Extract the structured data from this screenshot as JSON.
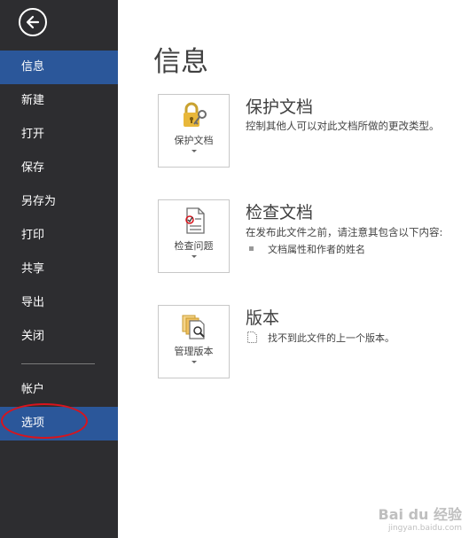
{
  "sidebar": {
    "items": [
      {
        "label": "信息"
      },
      {
        "label": "新建"
      },
      {
        "label": "打开"
      },
      {
        "label": "保存"
      },
      {
        "label": "另存为"
      },
      {
        "label": "打印"
      },
      {
        "label": "共享"
      },
      {
        "label": "导出"
      },
      {
        "label": "关闭"
      },
      {
        "label": "帐户"
      },
      {
        "label": "选项"
      }
    ],
    "active_item": "信息",
    "highlighted_item": "选项"
  },
  "main": {
    "title": "信息",
    "sections": [
      {
        "button_label": "保护文档",
        "heading": "保护文档",
        "description": "控制其他人可以对此文档所做的更改类型。",
        "icon": "lock-key-icon"
      },
      {
        "button_label": "检查问题",
        "heading": "检查文档",
        "description": "在发布此文件之前，请注意其包含以下内容:",
        "bullet": "文档属性和作者的姓名",
        "icon": "checklist-icon"
      },
      {
        "button_label": "管理版本",
        "heading": "版本",
        "description": "找不到此文件的上一个版本。",
        "icon": "versions-icon"
      }
    ]
  },
  "watermark": {
    "logo": "Bai du 经验",
    "url": "jingyan.baidu.com"
  },
  "colors": {
    "sidebar_bg": "#2d2d30",
    "active_bg": "#2b579a",
    "highlight_ring": "#d9141c"
  }
}
